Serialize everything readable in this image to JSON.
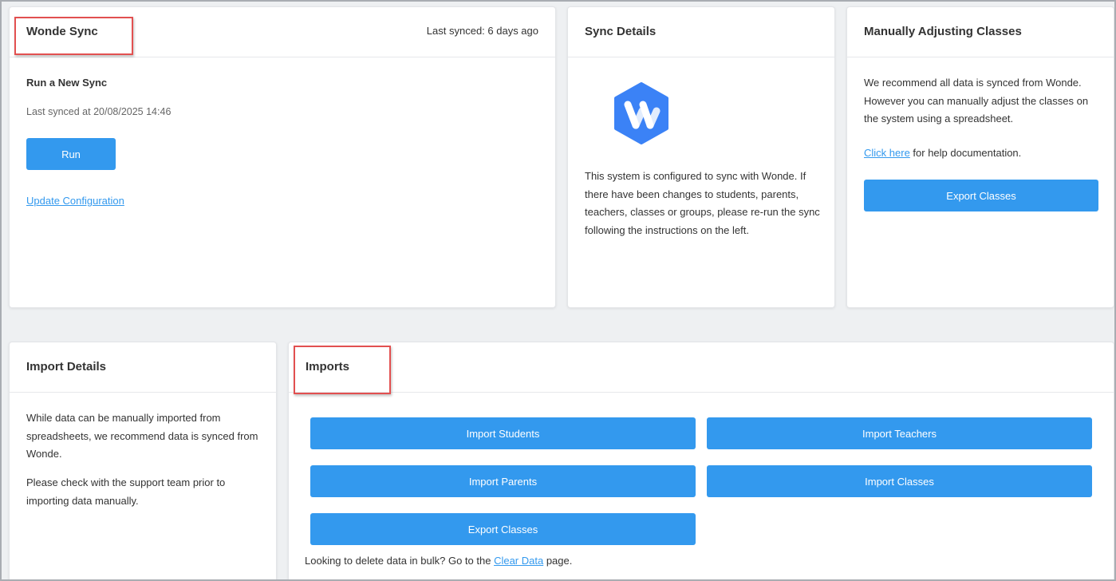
{
  "wonde_sync": {
    "title": "Wonde Sync",
    "last_synced_relative": "Last synced: 6 days ago",
    "run_heading": "Run a New Sync",
    "last_synced_at": "Last synced at 20/08/2025 14:46",
    "run_button": "Run",
    "update_config_link": "Update Configuration"
  },
  "sync_details": {
    "title": "Sync Details",
    "logo_icon": "wonde-logo-icon",
    "description": "This system is configured to sync with Wonde. If there have been changes to students, parents, teachers, classes or groups, please re-run the sync following the instructions on the left."
  },
  "manual_classes": {
    "title": "Manually Adjusting Classes",
    "description": "We recommend all data is synced from Wonde. However you can manually adjust the classes on the system using a spreadsheet.",
    "help_link": "Click here",
    "help_suffix": " for help documentation.",
    "export_button": "Export Classes"
  },
  "import_details": {
    "title": "Import Details",
    "para1": "While data can be manually imported from spreadsheets, we recommend data is synced from Wonde.",
    "para2": "Please check with the support team prior to importing data manually."
  },
  "imports": {
    "title": "Imports",
    "buttons": {
      "students": "Import Students",
      "teachers": "Import Teachers",
      "parents": "Import Parents",
      "classes": "Import Classes",
      "export_classes": "Export Classes"
    },
    "footer_prefix": "Looking to delete data in bulk? Go to the ",
    "footer_link": "Clear Data",
    "footer_suffix": " page."
  },
  "colors": {
    "accent": "#3399ee",
    "highlight": "#e25050",
    "logo": "#3b82f6"
  }
}
